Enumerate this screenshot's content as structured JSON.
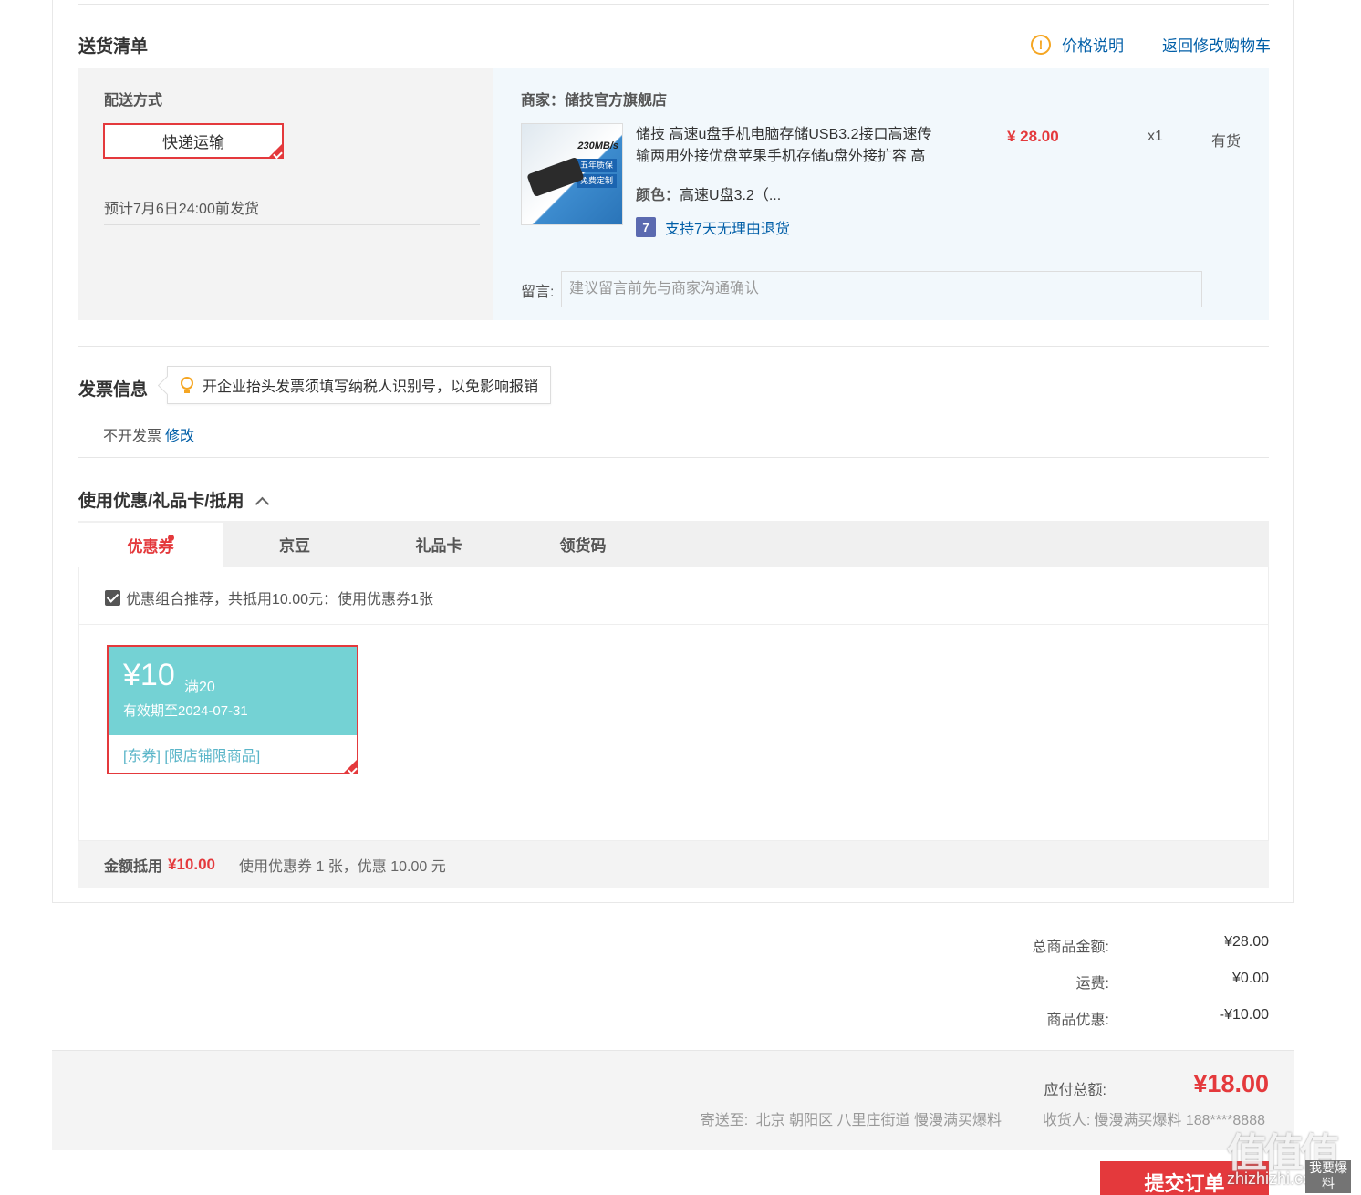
{
  "delivery": {
    "title": "送货清单",
    "price_note": "价格说明",
    "back_to_cart": "返回修改购物车",
    "ship_label": "配送方式",
    "ship_method": "快递运输",
    "ship_eta": "预计7月6日24:00前发货",
    "merchant": "商家：储技官方旗舰店",
    "product": {
      "title": "储技 高速u盘手机电脑存储USB3.2接口高速传输两用外接优盘苹果手机存储u盘外接扩容 高",
      "color_label": "颜色：",
      "color_value": "高速U盘3.2（...",
      "return_policy": "支持7天无理由退货",
      "return_icon": "7",
      "price": "¥ 28.00",
      "qty": "x1",
      "stock": "有货",
      "image_speed": "230MB/s",
      "image_tag1": "五年质保",
      "image_tag2": "免费定制"
    },
    "message_label": "留言:",
    "message_placeholder": "建议留言前先与商家沟通确认"
  },
  "invoice": {
    "title": "发票信息",
    "tip": "开企业抬头发票须填写纳税人识别号，以免影响报销",
    "value": "不开发票",
    "edit": "修改"
  },
  "coupons": {
    "title": "使用优惠/礼品卡/抵用",
    "tabs": [
      "优惠券",
      "京豆",
      "礼品卡",
      "领货码"
    ],
    "combo_text": "优惠组合推荐，共抵用10.00元：使用优惠券1张",
    "coupon": {
      "amount": "¥10",
      "condition": "满20",
      "valid": "有效期至2024-07-31",
      "tags": "[东券]  [限店铺限商品]"
    },
    "deduct_label": "金额抵用",
    "deduct_amount": "¥10.00",
    "deduct_desc": "使用优惠券 1 张，优惠 10.00 元"
  },
  "summary": {
    "rows": [
      {
        "label": "总商品金额:",
        "value": "¥28.00"
      },
      {
        "label": "运费:",
        "value": "¥0.00"
      },
      {
        "label": "商品优惠:",
        "value": "-¥10.00"
      }
    ],
    "pay_label": "应付总额:",
    "pay_total": "¥18.00",
    "ship_to_label": "寄送至:",
    "ship_to_address": "北京 朝阳区 八里庄街道 慢漫满买爆料",
    "receiver_label": "收货人:",
    "receiver": "慢漫满买爆料 188****8888",
    "submit": "提交订单"
  },
  "watermark": {
    "logo": "值值值",
    "site": "zhizhizhi.com",
    "badge": "我要爆料"
  },
  "colors": {
    "accent_red": "#e4393c",
    "link_blue": "#005ea7",
    "coupon_teal": "#74d2d4"
  }
}
